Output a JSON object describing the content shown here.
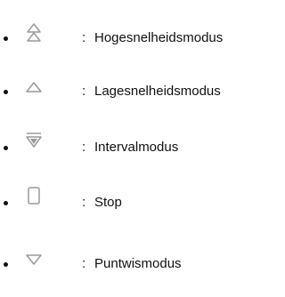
{
  "legend": {
    "items": [
      {
        "icon": "double-triangle-up-icon",
        "separator": ":",
        "label": "Hogesnelheidsmodus"
      },
      {
        "icon": "triangle-up-icon",
        "separator": ":",
        "label": "Lagesnelheidsmodus"
      },
      {
        "icon": "triangle-down-bar-icon",
        "separator": ":",
        "label": "Intervalmodus"
      },
      {
        "icon": "rounded-rectangle-icon",
        "separator": ":",
        "label": "Stop"
      },
      {
        "icon": "triangle-down-icon",
        "separator": ":",
        "label": "Puntwismodus"
      }
    ]
  },
  "colors": {
    "icon_stroke": "#9a9a9a",
    "text": "#111111"
  }
}
